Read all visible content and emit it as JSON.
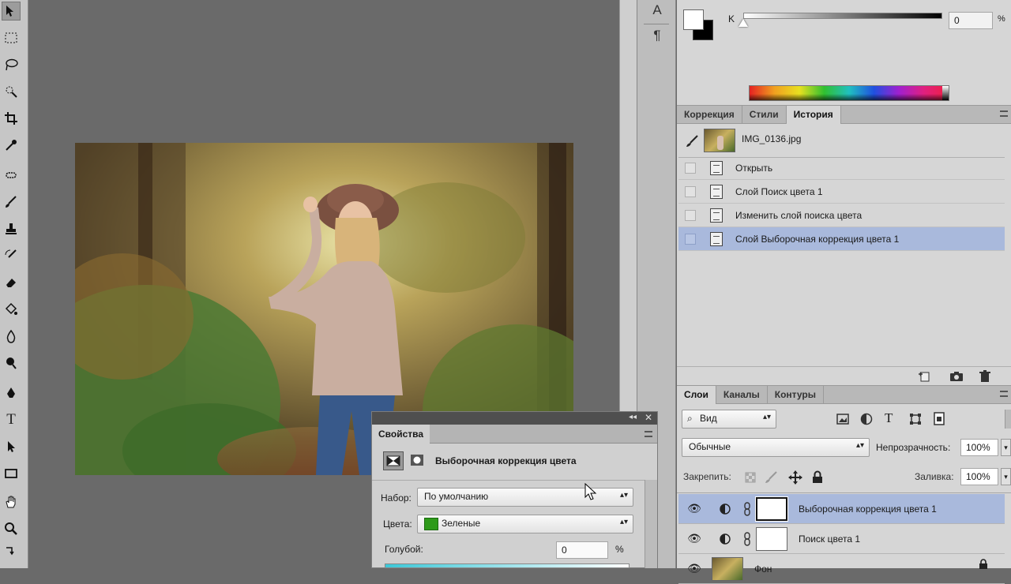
{
  "toolbar": {
    "tools": [
      "move-tool",
      "marquee-tool",
      "lasso-tool",
      "quick-selection-tool",
      "crop-tool",
      "eyedropper-tool",
      "healing-brush-tool",
      "brush-tool",
      "clone-stamp-tool",
      "history-brush-tool",
      "eraser-tool",
      "paint-bucket-tool",
      "blur-tool",
      "dodge-tool",
      "pen-tool",
      "type-tool",
      "path-selection-tool",
      "rectangle-tool",
      "hand-tool",
      "zoom-tool"
    ],
    "type_glyph": "T"
  },
  "dock": {
    "character_glyph": "A",
    "paragraph_glyph": "¶"
  },
  "color_panel": {
    "slider_label": "K",
    "value": "0",
    "unit": "%",
    "foreground": "#ffffff",
    "background": "#000000"
  },
  "history_panel": {
    "tabs": [
      "Коррекция",
      "Стили",
      "История"
    ],
    "active_tab": 2,
    "snapshot_name": "IMG_0136.jpg",
    "states": [
      {
        "label": "Открыть",
        "selected": false
      },
      {
        "label": "Слой Поиск цвета 1",
        "selected": false
      },
      {
        "label": "Изменить слой поиска цвета",
        "selected": false
      },
      {
        "label": "Слой Выборочная коррекция цвета 1",
        "selected": true
      }
    ]
  },
  "layers_panel": {
    "tabs": [
      "Слои",
      "Каналы",
      "Контуры"
    ],
    "active_tab": 0,
    "filter_kind": "Вид",
    "blend_mode": "Обычные",
    "opacity_label": "Непрозрачность:",
    "opacity_value": "100%",
    "lock_label": "Закрепить:",
    "fill_label": "Заливка:",
    "fill_value": "100%",
    "layers": [
      {
        "name": "Выборочная коррекция цвета 1",
        "selected": true
      },
      {
        "name": "Поиск цвета 1",
        "selected": false
      },
      {
        "name": "Фон",
        "selected": false
      }
    ]
  },
  "properties_panel": {
    "tab": "Свойства",
    "title": "Выборочная коррекция цвета",
    "preset_label": "Набор:",
    "preset_value": "По умолчанию",
    "colors_label": "Цвета:",
    "colors_value": "Зеленые",
    "colors_swatch": "#2e9a1a",
    "cyan_label": "Голубой:",
    "cyan_value": "0",
    "cyan_unit": "%"
  },
  "accent": {
    "selection": "#a9b9dc",
    "panel_bg": "#d6d6d6"
  }
}
